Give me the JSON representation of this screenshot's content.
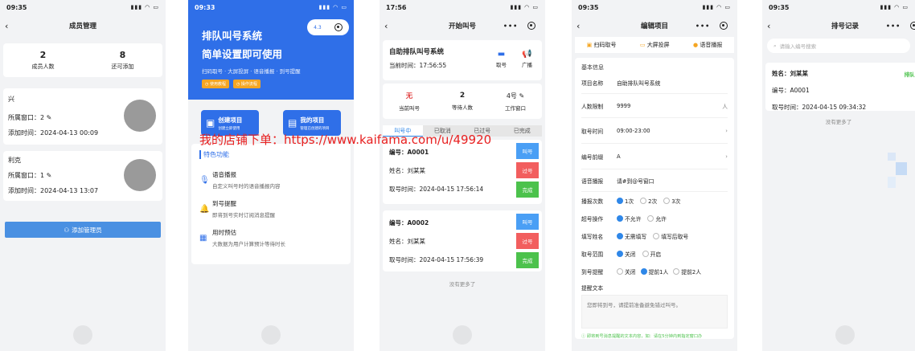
{
  "watermark": "我的店铺下单：https://www.kaifama.com/u/49920",
  "p1": {
    "time": "09:35",
    "title": "成员管理",
    "stats": [
      {
        "value": "2",
        "label": "成员人数"
      },
      {
        "value": "8",
        "label": "还可添加"
      }
    ],
    "members": [
      {
        "name": "兴",
        "window": "所属窗口：2",
        "added": "添加时间：2024-04-13 00:09"
      },
      {
        "name": "利克",
        "window": "所属窗口：1",
        "added": "添加时间：2024-04-13 13:07"
      }
    ],
    "add_button": "添加管理员"
  },
  "p2": {
    "time": "09:33",
    "badge": "4.3",
    "hero_title_1": "排队叫号系统",
    "hero_title_2": "简单设置即可使用",
    "hero_sub": "扫码取号 · 大屏投屏 · 语音播报 · 到号提醒",
    "tag1": "使用教程",
    "tag2": "操作流程",
    "btn1_title": "创建项目",
    "btn1_sub": "创建立即使用",
    "btn2_title": "我的项目",
    "btn2_sub": "管理已创建的项目",
    "section": "特色功能",
    "features": [
      {
        "title": "语音播报",
        "desc": "自定义叫号时的语音播报内容"
      },
      {
        "title": "到号提醒",
        "desc": "即将到号实时订阅消息提醒"
      },
      {
        "title": "用时预估",
        "desc": "大数据为用户计算预计等待时长"
      }
    ]
  },
  "p3": {
    "time": "17:56",
    "title": "开始叫号",
    "system": "自助排队叫号系统",
    "current_time": "当前时间：17:56:55",
    "take_label": "取号",
    "broadcast_label": "广播",
    "stats": [
      {
        "value": "无",
        "label": "当前叫号"
      },
      {
        "value": "2",
        "label": "等待人数"
      },
      {
        "value": "4号",
        "label": "工作窗口"
      }
    ],
    "tabs": [
      "叫号中",
      "已取消",
      "已过号",
      "已完成"
    ],
    "tickets": [
      {
        "no": "编号：A0001",
        "name": "姓名：刘某某",
        "time": "取号时间：2024-04-15 17:56:14"
      },
      {
        "no": "编号：A0002",
        "name": "姓名：刘某某",
        "time": "取号时间：2024-04-15 17:56:39"
      }
    ],
    "btn_call": "叫号",
    "btn_pass": "过号",
    "btn_done": "完成",
    "no_more": "没有更多了"
  },
  "p4": {
    "time": "09:35",
    "title": "编辑项目",
    "top_tabs": [
      "扫码取号",
      "大屏投屏",
      "语音播报"
    ],
    "section": "基本信息",
    "fields": [
      {
        "label": "项目名称",
        "value": "自助排队叫号系统",
        "suffix": ""
      },
      {
        "label": "人数限制",
        "value": "9999",
        "suffix": "人"
      },
      {
        "label": "取号时间",
        "value": "09:00-23:00",
        "suffix": "›"
      },
      {
        "label": "编号前缀",
        "value": "A",
        "suffix": "›"
      },
      {
        "label": "语音播报",
        "value": "请#到@号窗口",
        "suffix": ""
      }
    ],
    "options": [
      {
        "label": "播报次数",
        "choices": [
          "1次",
          "2次",
          "3次"
        ]
      },
      {
        "label": "超号操作",
        "choices": [
          "不允许",
          "允许"
        ]
      },
      {
        "label": "填写姓名",
        "choices": [
          "无需填写",
          "填写后取号"
        ]
      },
      {
        "label": "取号范围",
        "choices": [
          "关闭",
          "开启"
        ]
      },
      {
        "label": "到号提醒",
        "choices": [
          "关闭",
          "提前1人",
          "提前2人"
        ]
      }
    ],
    "remind_label": "提醒文本",
    "remind_text": "您即将到号，请提前准备避免错过叫号。",
    "tip": "即将到号消息提醒的文本内容，如：请在5分钟内到指定窗口办"
  },
  "p5": {
    "time": "09:35",
    "title": "排号记录",
    "search_placeholder": "请输入编号搜索",
    "record_name": "姓名：刘某某",
    "record_status": "排队中",
    "record_no": "编号：A0001",
    "record_time": "取号时间：2024-04-15 09:34:32",
    "no_more": "没有更多了"
  },
  "colors": {
    "primary": "#2f87e8",
    "red": "#f25e5e",
    "green": "#4cc24c",
    "orange": "#f5a623",
    "hero": "#2f6fe8"
  }
}
